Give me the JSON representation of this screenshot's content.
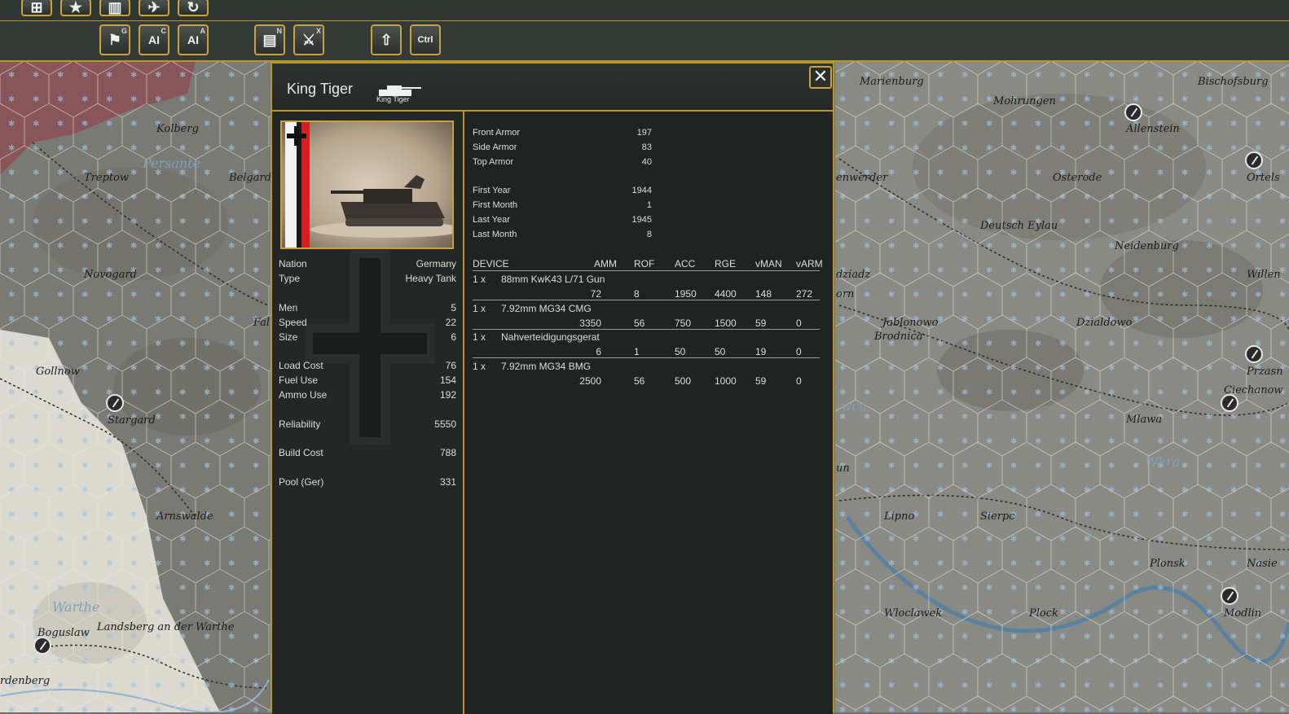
{
  "toolbar_top": {
    "buttons": [
      {
        "icon": "map-globe-icon"
      },
      {
        "icon": "star-icon"
      },
      {
        "icon": "building-icon"
      },
      {
        "icon": "aircraft-icon"
      },
      {
        "icon": "rotate-icon"
      }
    ]
  },
  "toolbar_second": {
    "buttons": [
      {
        "icon": "flag-arrow-icon",
        "badge": "G",
        "text": ""
      },
      {
        "icon": "factory-ai-icon",
        "badge": "C",
        "text": "AI"
      },
      {
        "icon": "plane-ai-icon",
        "badge": "A",
        "text": "AI"
      },
      {
        "icon": "report-icon",
        "badge": "N",
        "text": ""
      },
      {
        "icon": "battle-icon",
        "badge": "X",
        "text": ""
      },
      {
        "icon": "upload-icon",
        "badge": "",
        "text": ""
      },
      {
        "icon": "ctrl-key-icon",
        "badge": "",
        "text": "Ctrl"
      }
    ]
  },
  "unit": {
    "name": "King Tiger",
    "icon_label": "King Tiger",
    "close_symbol": "✕",
    "left_stats": [
      {
        "label": "Nation",
        "value": "Germany"
      },
      {
        "label": "Type",
        "value": "Heavy Tank"
      },
      {
        "label": "Men",
        "value": "5"
      },
      {
        "label": "Speed",
        "value": "22"
      },
      {
        "label": "Size",
        "value": "6"
      },
      {
        "label": "Load Cost",
        "value": "76"
      },
      {
        "label": "Fuel Use",
        "value": "154"
      },
      {
        "label": "Ammo Use",
        "value": "192"
      },
      {
        "label": "Reliability",
        "value": "5550"
      },
      {
        "label": "Build Cost",
        "value": "788"
      },
      {
        "label": "Pool (Ger)",
        "value": "331"
      }
    ],
    "armor": [
      {
        "label": "Front Armor",
        "value": "197"
      },
      {
        "label": "Side Armor",
        "value": "83"
      },
      {
        "label": "Top Armor",
        "value": "40"
      }
    ],
    "dates": [
      {
        "label": "First Year",
        "value": "1944"
      },
      {
        "label": "First Month",
        "value": "1"
      },
      {
        "label": "Last Year",
        "value": "1945"
      },
      {
        "label": "Last Month",
        "value": "8"
      }
    ],
    "device_columns": [
      "DEVICE",
      "AMM",
      "ROF",
      "ACC",
      "RGE",
      "vMAN",
      "vARM"
    ],
    "devices": [
      {
        "qty": "1 x",
        "name": "88mm KwK43 L/71 Gun",
        "stats": [
          "72",
          "8",
          "1950",
          "4400",
          "148",
          "272"
        ]
      },
      {
        "qty": "1 x",
        "name": "7.92mm MG34 CMG",
        "stats": [
          "3350",
          "56",
          "750",
          "1500",
          "59",
          "0"
        ]
      },
      {
        "qty": "1 x",
        "name": "Nahverteidigungsgerat",
        "stats": [
          "6",
          "1",
          "50",
          "50",
          "19",
          "0"
        ]
      },
      {
        "qty": "1 x",
        "name": "7.92mm MG34 BMG",
        "stats": [
          "2500",
          "56",
          "500",
          "1000",
          "59",
          "0"
        ]
      }
    ]
  },
  "map": {
    "cities_left": [
      "Kolberg",
      "Treptow",
      "Belgard",
      "Novogard",
      "Fal",
      "Gollnow",
      "Stargard",
      "Arnswalde",
      "Boguslaw",
      "Landsberg an der Warthe",
      "rdenberg"
    ],
    "rivers_left": [
      "Persante",
      "Warthe"
    ],
    "cities_right": [
      "Marienburg",
      "Mohrungen",
      "Bischofsburg",
      "Allenstein",
      "enwerder",
      "Osterode",
      "Ortels",
      "Deutsch Eylau",
      "Neidenburg",
      "Willen",
      "dziadz",
      "orn",
      "Jablonowo",
      "Brodnica",
      "Dzialdowo",
      "Przasn",
      "Ciechanow",
      "Mlawa",
      "un",
      "Lipno",
      "Sierpc",
      "Plonsk",
      "Nasie",
      "Wloclawek",
      "Plock",
      "Modlin"
    ],
    "rivers_right": [
      "wca",
      "Wkra"
    ]
  }
}
